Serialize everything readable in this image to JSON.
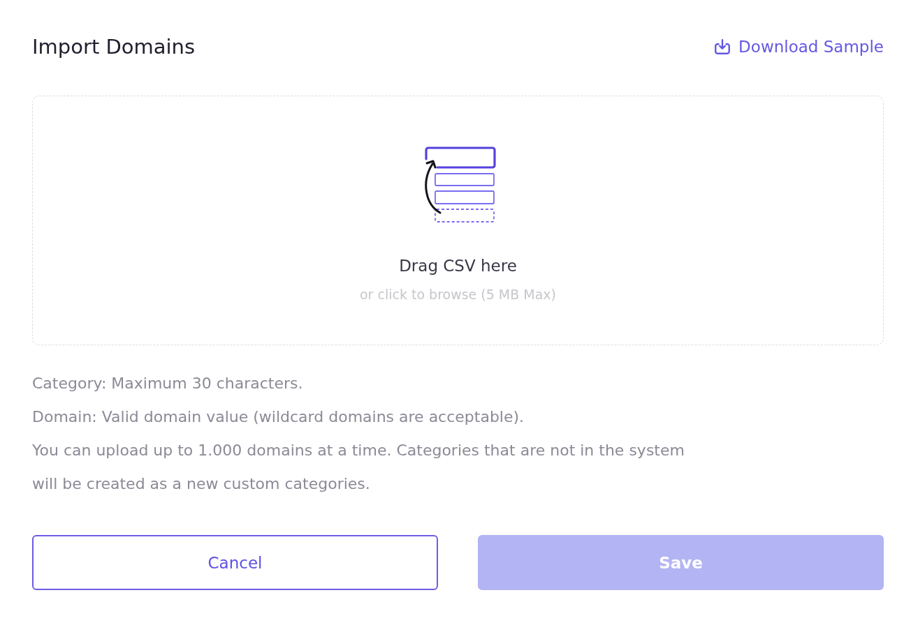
{
  "dialog": {
    "title": "Import Domains",
    "download_link": {
      "label": "Download Sample"
    },
    "drop_zone": {
      "title": "Drag CSV here",
      "hint": "or click to browse (5 MB Max)"
    },
    "notes": [
      "Category: Maximum 30 characters.",
      "Domain: Valid domain value (wildcard domains are acceptable).",
      "You can upload up to 1.000 domains at a time. Categories that are not in the system will be created as a new custom categories."
    ],
    "buttons": [
      {
        "label": "Cancel",
        "kind": "secondary",
        "disabled": false
      },
      {
        "label": "Save",
        "kind": "primary",
        "disabled": true
      }
    ]
  }
}
